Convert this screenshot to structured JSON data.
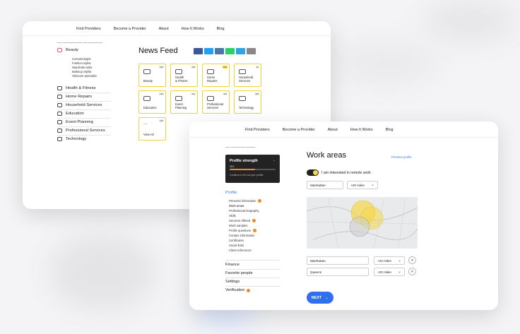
{
  "colors": {
    "accent": "#2f6ff0",
    "badge": "#f6d84a",
    "orange": "#f08a24",
    "tile_border": "#f0d23a"
  },
  "nav": [
    "Find Providers",
    "Become a Provider",
    "About",
    "How It Works",
    "Blog"
  ],
  "sidebar": {
    "beauty": {
      "label": "Beauty",
      "subs": [
        "Cosmetologist",
        "Fashion stylist",
        "Wardrobe tailor",
        "Makeup Stylist",
        "Skincare specialist"
      ]
    },
    "categories": [
      "Health & Fitness",
      "Home Repairs",
      "Household Services",
      "Education",
      "Event Planning",
      "Professional Services",
      "Technology"
    ]
  },
  "news_feed": {
    "title": "News Feed",
    "share_colors": [
      "#3b5998",
      "#1da1f2",
      "#4a76a8",
      "#25d366",
      "#2ca5e0",
      "#888888"
    ],
    "tiles": [
      {
        "label": "Beauty",
        "count": "192",
        "highlight": false
      },
      {
        "label": "Health\n& Fitness",
        "count": "118",
        "highlight": false
      },
      {
        "label": "Home\nRepairs",
        "count": "100",
        "highlight": true
      },
      {
        "label": "Household\nServices",
        "count": "42",
        "highlight": false
      },
      {
        "label": "Education",
        "count": "124",
        "highlight": false
      },
      {
        "label": "Event\nPlanning",
        "count": "114",
        "highlight": false
      },
      {
        "label": "Professional\nServices",
        "count": "113",
        "highlight": false
      },
      {
        "label": "Technology",
        "count": "118",
        "highlight": false
      },
      {
        "label": "View All",
        "count": "100",
        "highlight": false,
        "dots": "..."
      }
    ]
  },
  "profile_strength": {
    "title": "Profile strength",
    "percent": 0.55,
    "percent_label": "55%",
    "hint": "Continue to fill out your profile."
  },
  "profile_menu": {
    "heading": "Profile",
    "items": [
      {
        "label": "Personal information",
        "badge": "1"
      },
      {
        "label": "Work areas",
        "badge": ""
      },
      {
        "label": "Professional biography",
        "badge": ""
      },
      {
        "label": "Skills",
        "badge": ""
      },
      {
        "label": "Services offered",
        "badge": "1"
      },
      {
        "label": "Work samples",
        "badge": ""
      },
      {
        "label": "Profile questions",
        "badge": "1"
      },
      {
        "label": "Contact information",
        "badge": ""
      },
      {
        "label": "Certificates",
        "badge": ""
      },
      {
        "label": "Social links",
        "badge": ""
      },
      {
        "label": "Client references",
        "badge": ""
      }
    ],
    "sections": [
      {
        "label": "Finance",
        "badge": ""
      },
      {
        "label": "Favorite people",
        "badge": ""
      },
      {
        "label": "Settings",
        "badge": ""
      },
      {
        "label": "Verification",
        "badge": "1"
      }
    ]
  },
  "work_areas": {
    "title": "Work areas",
    "preview_link": "Preview profile",
    "remote_label": "I am interested in remote work",
    "remote_on": true,
    "top_city": "Manhattan",
    "top_radius": "+20 miles",
    "areas": [
      {
        "city": "Manhattan",
        "radius": "+20 miles"
      },
      {
        "city": "Queens",
        "radius": "+20 miles"
      }
    ],
    "next_label": "NEXT"
  }
}
